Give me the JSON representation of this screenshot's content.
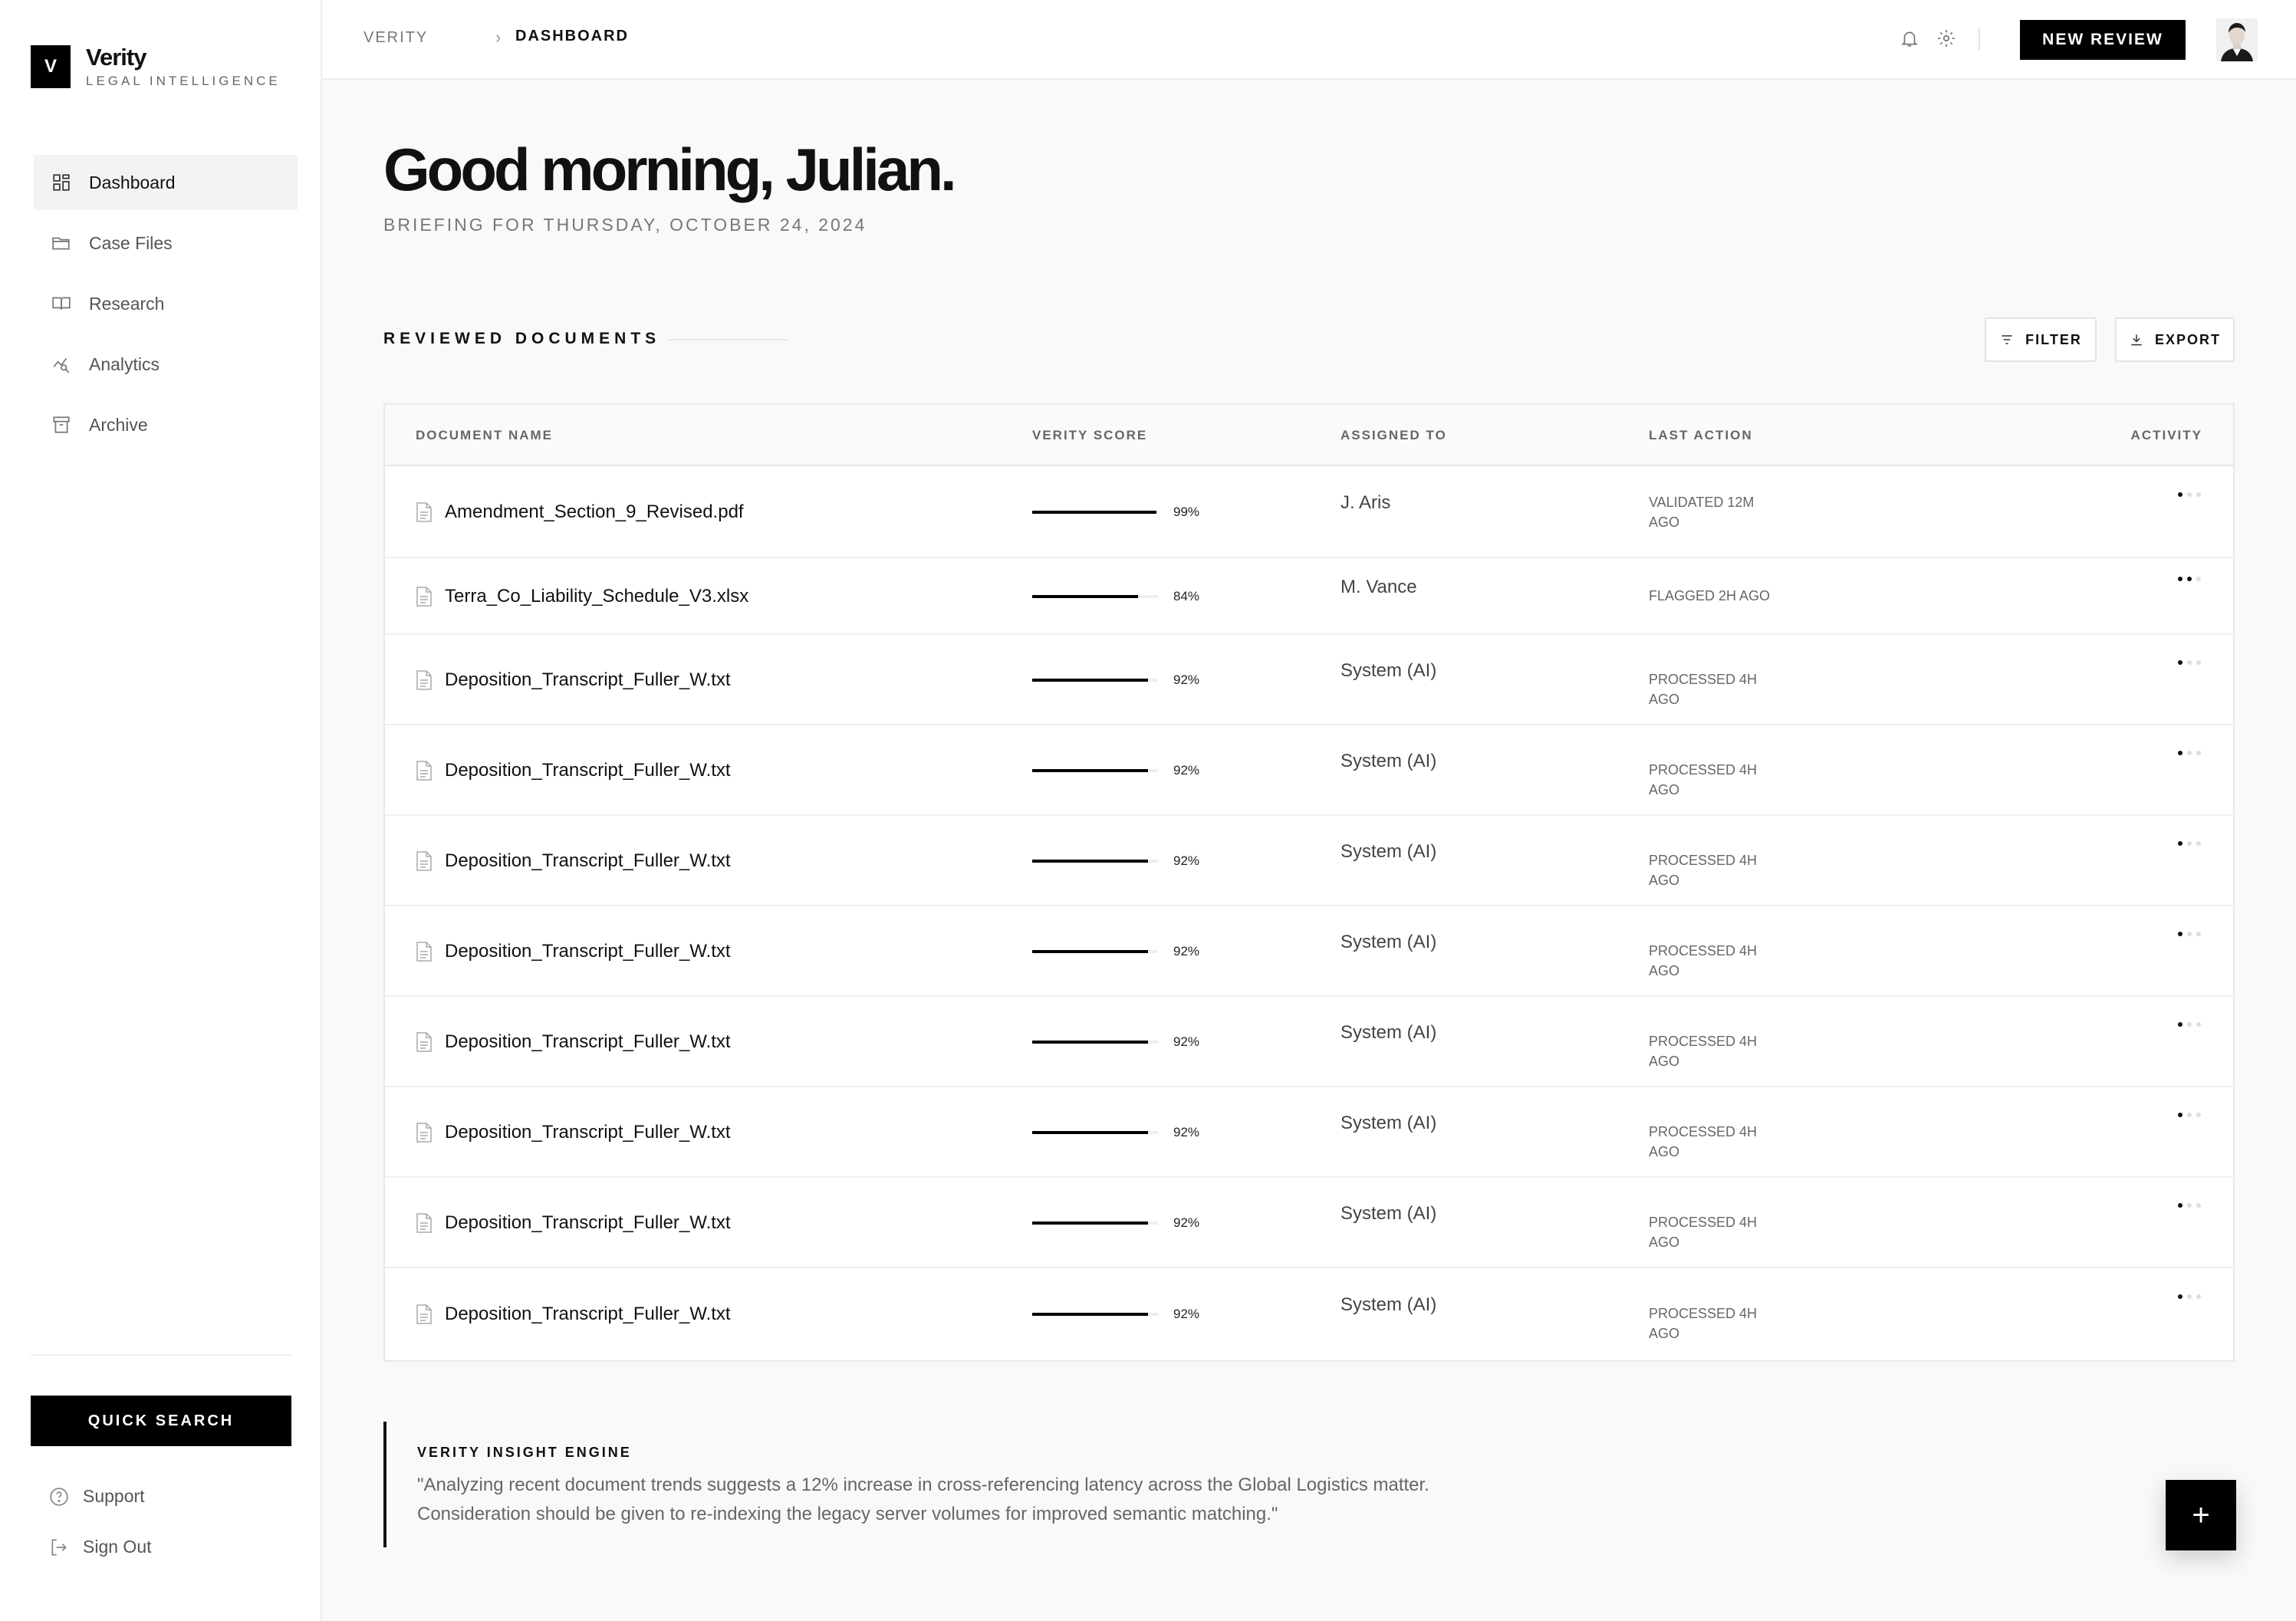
{
  "brand": {
    "mark": "V",
    "name": "Verity",
    "tagline": "LEGAL INTELLIGENCE"
  },
  "sidebar": {
    "items": [
      {
        "label": "Dashboard",
        "icon": "grid-icon",
        "active": true
      },
      {
        "label": "Case Files",
        "icon": "folder-icon",
        "active": false
      },
      {
        "label": "Research",
        "icon": "book-icon",
        "active": false
      },
      {
        "label": "Analytics",
        "icon": "chart-icon",
        "active": false
      },
      {
        "label": "Archive",
        "icon": "archive-icon",
        "active": false
      }
    ],
    "quick_search": "QUICK SEARCH",
    "support": "Support",
    "sign_out": "Sign Out"
  },
  "topbar": {
    "breadcrumb_root": "VERITY",
    "breadcrumb_sep": "›",
    "breadcrumb_current": "DASHBOARD",
    "new_review": "NEW REVIEW"
  },
  "main": {
    "greeting": "Good morning, Julian.",
    "briefing": "BRIEFING FOR THURSDAY, OCTOBER 24, 2024",
    "section_title": "REVIEWED DOCUMENTS",
    "filter_label": "FILTER",
    "export_label": "EXPORT"
  },
  "table": {
    "headers": {
      "name": "DOCUMENT NAME",
      "score": "VERITY SCORE",
      "assigned": "ASSIGNED TO",
      "last_action": "LAST ACTION",
      "activity": "ACTIVITY"
    },
    "rows": [
      {
        "name": "Amendment_Section_9_Revised.pdf",
        "score": 99,
        "score_label": "99%",
        "assigned": "J. Aris",
        "last_action": "VALIDATED 12M AGO",
        "activity": 1
      },
      {
        "name": "Terra_Co_Liability_Schedule_V3.xlsx",
        "score": 84,
        "score_label": "84%",
        "assigned": "M. Vance",
        "last_action": "FLAGGED 2H AGO",
        "activity": 2
      },
      {
        "name": "Deposition_Transcript_Fuller_W.txt",
        "score": 92,
        "score_label": "92%",
        "assigned": "System (AI)",
        "last_action": "PROCESSED 4H AGO",
        "activity": 1
      },
      {
        "name": "Deposition_Transcript_Fuller_W.txt",
        "score": 92,
        "score_label": "92%",
        "assigned": "System (AI)",
        "last_action": "PROCESSED 4H AGO",
        "activity": 1
      },
      {
        "name": "Deposition_Transcript_Fuller_W.txt",
        "score": 92,
        "score_label": "92%",
        "assigned": "System (AI)",
        "last_action": "PROCESSED 4H AGO",
        "activity": 1
      },
      {
        "name": "Deposition_Transcript_Fuller_W.txt",
        "score": 92,
        "score_label": "92%",
        "assigned": "System (AI)",
        "last_action": "PROCESSED 4H AGO",
        "activity": 1
      },
      {
        "name": "Deposition_Transcript_Fuller_W.txt",
        "score": 92,
        "score_label": "92%",
        "assigned": "System (AI)",
        "last_action": "PROCESSED 4H AGO",
        "activity": 1
      },
      {
        "name": "Deposition_Transcript_Fuller_W.txt",
        "score": 92,
        "score_label": "92%",
        "assigned": "System (AI)",
        "last_action": "PROCESSED 4H AGO",
        "activity": 1
      },
      {
        "name": "Deposition_Transcript_Fuller_W.txt",
        "score": 92,
        "score_label": "92%",
        "assigned": "System (AI)",
        "last_action": "PROCESSED 4H AGO",
        "activity": 1
      },
      {
        "name": "Deposition_Transcript_Fuller_W.txt",
        "score": 92,
        "score_label": "92%",
        "assigned": "System (AI)",
        "last_action": "PROCESSED 4H AGO",
        "activity": 1
      }
    ]
  },
  "insight": {
    "title": "VERITY INSIGHT ENGINE",
    "body": "\"Analyzing recent document trends suggests a 12% increase in cross-referencing latency across the Global Logistics matter. Consideration should be given to re-indexing the legacy server volumes for improved semantic matching.\""
  },
  "fab": {
    "label": "+"
  },
  "colors": {
    "accent": "#000000",
    "background": "#f9f9f9",
    "surface": "#ffffff",
    "border": "#e8e8e8",
    "muted_text": "#777777"
  }
}
